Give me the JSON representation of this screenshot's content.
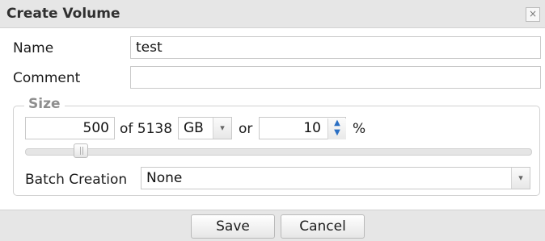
{
  "dialog": {
    "title": "Create Volume",
    "close_label": "×"
  },
  "form": {
    "name_label": "Name",
    "name_value": "test",
    "comment_label": "Comment",
    "comment_value": ""
  },
  "size": {
    "legend": "Size",
    "amount_value": "500",
    "of_text": "of 5138",
    "unit_selected": "GB",
    "or_text": "or",
    "percent_value": "10",
    "percent_symbol": "%",
    "slider_level_percent": 10
  },
  "batch": {
    "label": "Batch Creation",
    "selected": "None"
  },
  "buttons": {
    "save": "Save",
    "cancel": "Cancel"
  },
  "icons": {
    "close": "close-icon",
    "dropdown": "chevron-down-icon",
    "spinner_up": "chevron-up-icon",
    "spinner_down": "chevron-down-icon"
  }
}
